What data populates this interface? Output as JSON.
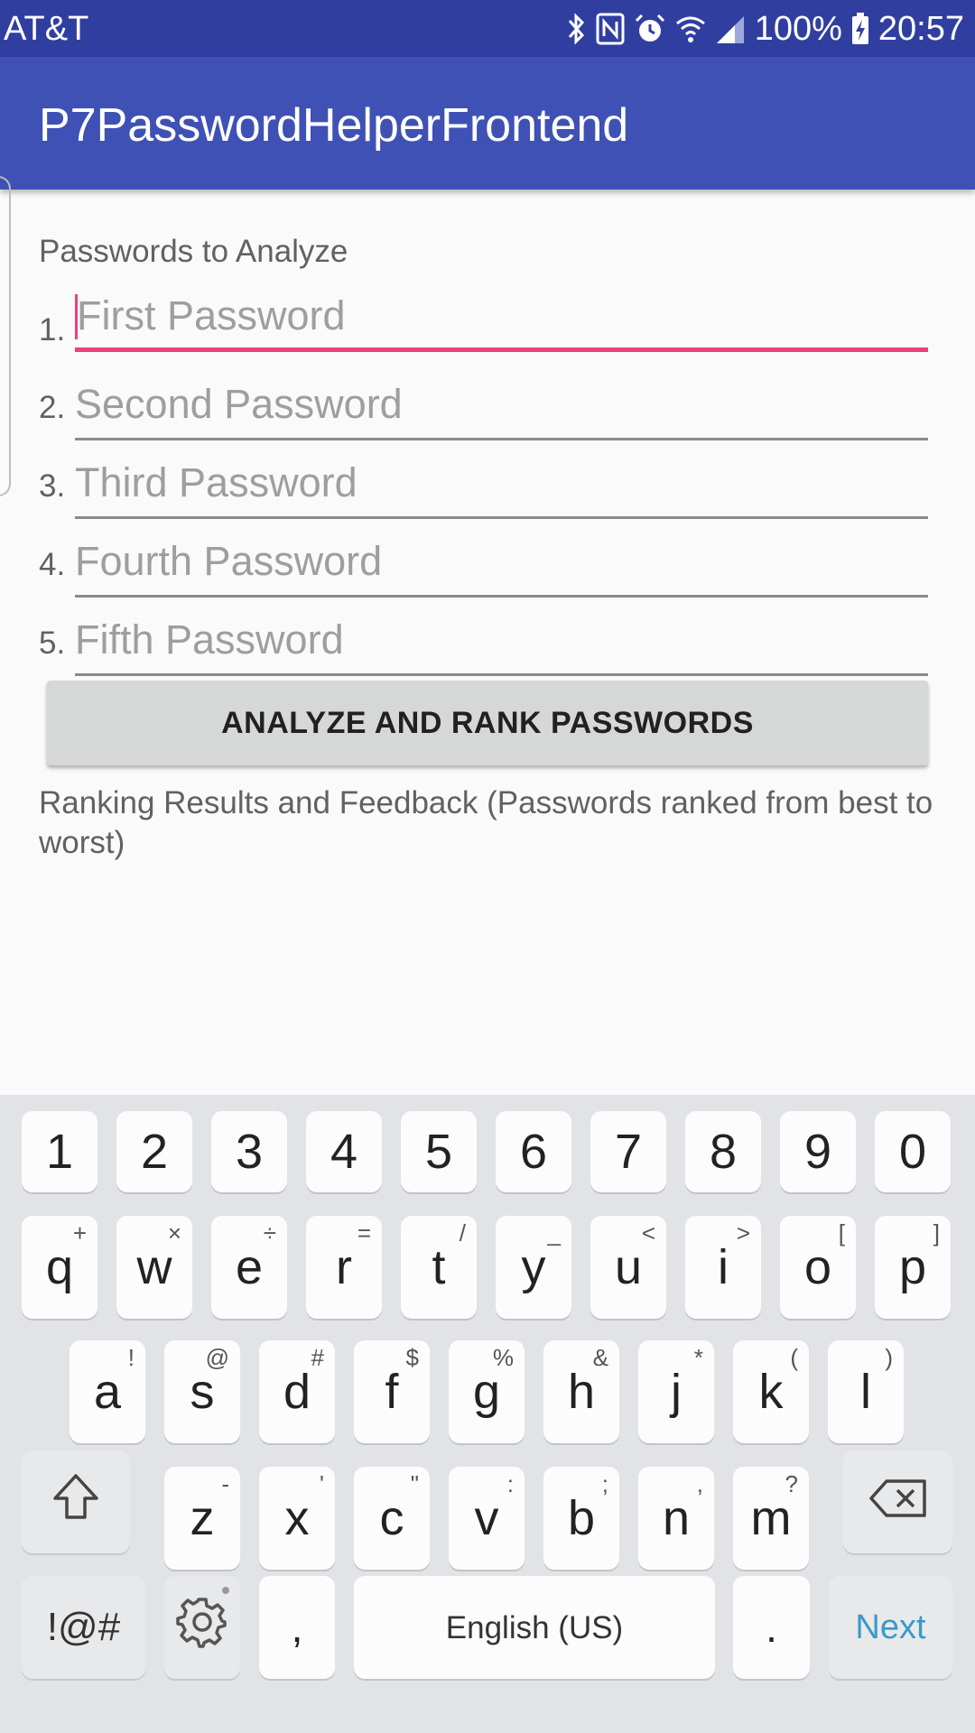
{
  "status_bar": {
    "carrier": "AT&T",
    "battery": "100%",
    "time": "20:57",
    "icons": [
      "bluetooth-icon",
      "nfc-icon",
      "alarm-icon",
      "wifi-icon",
      "signal-icon",
      "battery-charging-icon"
    ]
  },
  "app_bar": {
    "title": "P7PasswordHelperFrontend"
  },
  "form": {
    "section_label": "Passwords to Analyze",
    "fields": [
      {
        "number": "1.",
        "placeholder": "First Password"
      },
      {
        "number": "2.",
        "placeholder": "Second Password"
      },
      {
        "number": "3.",
        "placeholder": "Third Password"
      },
      {
        "number": "4.",
        "placeholder": "Fourth Password"
      },
      {
        "number": "5.",
        "placeholder": "Fifth Password"
      }
    ],
    "analyze_button": "ANALYZE AND RANK PASSWORDS",
    "results_label": "Ranking Results and Feedback (Passwords ranked from best to worst)"
  },
  "colors": {
    "status_bar": "#303f9f",
    "app_bar": "#3f51b5",
    "focus_accent": "#ec407a",
    "next_key": "#3a9ac9"
  },
  "keyboard": {
    "numbers": [
      "1",
      "2",
      "3",
      "4",
      "5",
      "6",
      "7",
      "8",
      "9",
      "0"
    ],
    "row1": [
      {
        "k": "q",
        "s": "+"
      },
      {
        "k": "w",
        "s": "×"
      },
      {
        "k": "e",
        "s": "÷"
      },
      {
        "k": "r",
        "s": "="
      },
      {
        "k": "t",
        "s": "/"
      },
      {
        "k": "y",
        "s": "_"
      },
      {
        "k": "u",
        "s": "<"
      },
      {
        "k": "i",
        "s": ">"
      },
      {
        "k": "o",
        "s": "["
      },
      {
        "k": "p",
        "s": "]"
      }
    ],
    "row2": [
      {
        "k": "a",
        "s": "!"
      },
      {
        "k": "s",
        "s": "@"
      },
      {
        "k": "d",
        "s": "#"
      },
      {
        "k": "f",
        "s": "$"
      },
      {
        "k": "g",
        "s": "%"
      },
      {
        "k": "h",
        "s": "&"
      },
      {
        "k": "j",
        "s": "*"
      },
      {
        "k": "k",
        "s": "("
      },
      {
        "k": "l",
        "s": ")"
      }
    ],
    "row3": [
      {
        "k": "z",
        "s": "-"
      },
      {
        "k": "x",
        "s": "'"
      },
      {
        "k": "c",
        "s": "\""
      },
      {
        "k": "v",
        "s": ":"
      },
      {
        "k": "b",
        "s": ";"
      },
      {
        "k": "n",
        "s": ","
      },
      {
        "k": "m",
        "s": "?"
      }
    ],
    "symbols_key": "!@#",
    "comma_key": ",",
    "space_key": "English (US)",
    "period_key": ".",
    "next_key": "Next"
  }
}
